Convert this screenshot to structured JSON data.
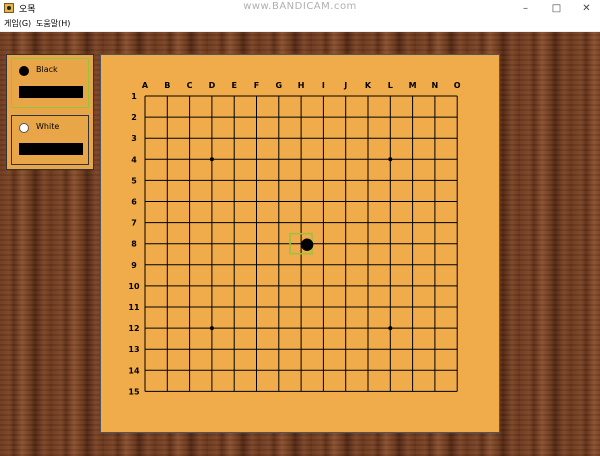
{
  "window": {
    "title": "오목",
    "watermark": "www.BANDICAM.com",
    "minimize_symbol": "–",
    "maximize_symbol": "□",
    "close_symbol": "✕"
  },
  "menu": {
    "items": [
      "게임(G)",
      "도움말(H)"
    ]
  },
  "players": {
    "black": {
      "label": "Black",
      "active": true
    },
    "white": {
      "label": "White",
      "active": false
    }
  },
  "board": {
    "columns": [
      "A",
      "B",
      "C",
      "D",
      "E",
      "F",
      "G",
      "H",
      "I",
      "J",
      "K",
      "L",
      "M",
      "N",
      "O"
    ],
    "rows": [
      "1",
      "2",
      "3",
      "4",
      "5",
      "6",
      "7",
      "8",
      "9",
      "10",
      "11",
      "12",
      "13",
      "14",
      "15"
    ],
    "star_points": [
      [
        "D",
        "4"
      ],
      [
        "L",
        "4"
      ],
      [
        "D",
        "12"
      ],
      [
        "L",
        "12"
      ]
    ],
    "stones": [
      {
        "col": "H",
        "row": "8",
        "color": "black"
      }
    ],
    "highlight": {
      "col": "H",
      "row": "8"
    },
    "highlight_color": "#9ac23c",
    "board_color": "#f0ac4a"
  }
}
